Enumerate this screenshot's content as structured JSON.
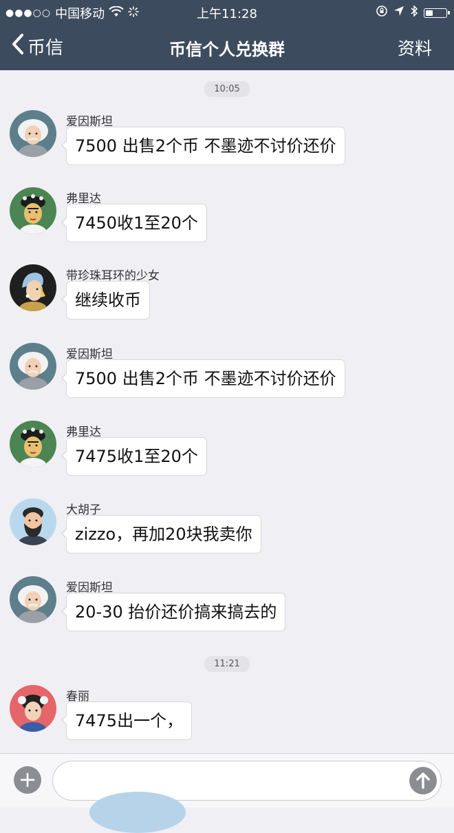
{
  "status_bar": {
    "signal_dots": "●●●○○",
    "carrier": "中国移动",
    "time": "上午11:28"
  },
  "nav": {
    "back_label": "币信",
    "title": "币信个人兑换群",
    "right_label": "资料"
  },
  "chat": {
    "timestamps": [
      "10:05",
      "11:21"
    ],
    "messages": [
      {
        "sender": "爱因斯坦",
        "text": "7500 出售2个币  不墨迹不讨价还价",
        "avatar": "einstein-avatar"
      },
      {
        "sender": "弗里达",
        "text": "7450收1至20个",
        "avatar": "frida-avatar"
      },
      {
        "sender": "带珍珠耳环的少女",
        "text": "继续收币",
        "avatar": "pearl-earring-girl-avatar"
      },
      {
        "sender": "爱因斯坦",
        "text": "7500 出售2个币  不墨迹不讨价还价",
        "avatar": "einstein-avatar"
      },
      {
        "sender": "弗里达",
        "text": "7475收1至20个",
        "avatar": "frida-avatar"
      },
      {
        "sender": "大胡子",
        "text": "zizzo，再加20块我卖你",
        "avatar": "bearded-man-avatar"
      },
      {
        "sender": "爱因斯坦",
        "text": "20-30 抬价还价搞来搞去的",
        "avatar": "einstein-avatar"
      },
      {
        "sender": "春丽",
        "text": "7475出一个，",
        "avatar": "chun-li-avatar"
      }
    ]
  },
  "input": {
    "placeholder": ""
  },
  "colors": {
    "nav_background": "#3d4b5e",
    "chat_background": "#efeff4",
    "bubble_background": "#ffffff",
    "button_gray": "#8c8c93"
  }
}
